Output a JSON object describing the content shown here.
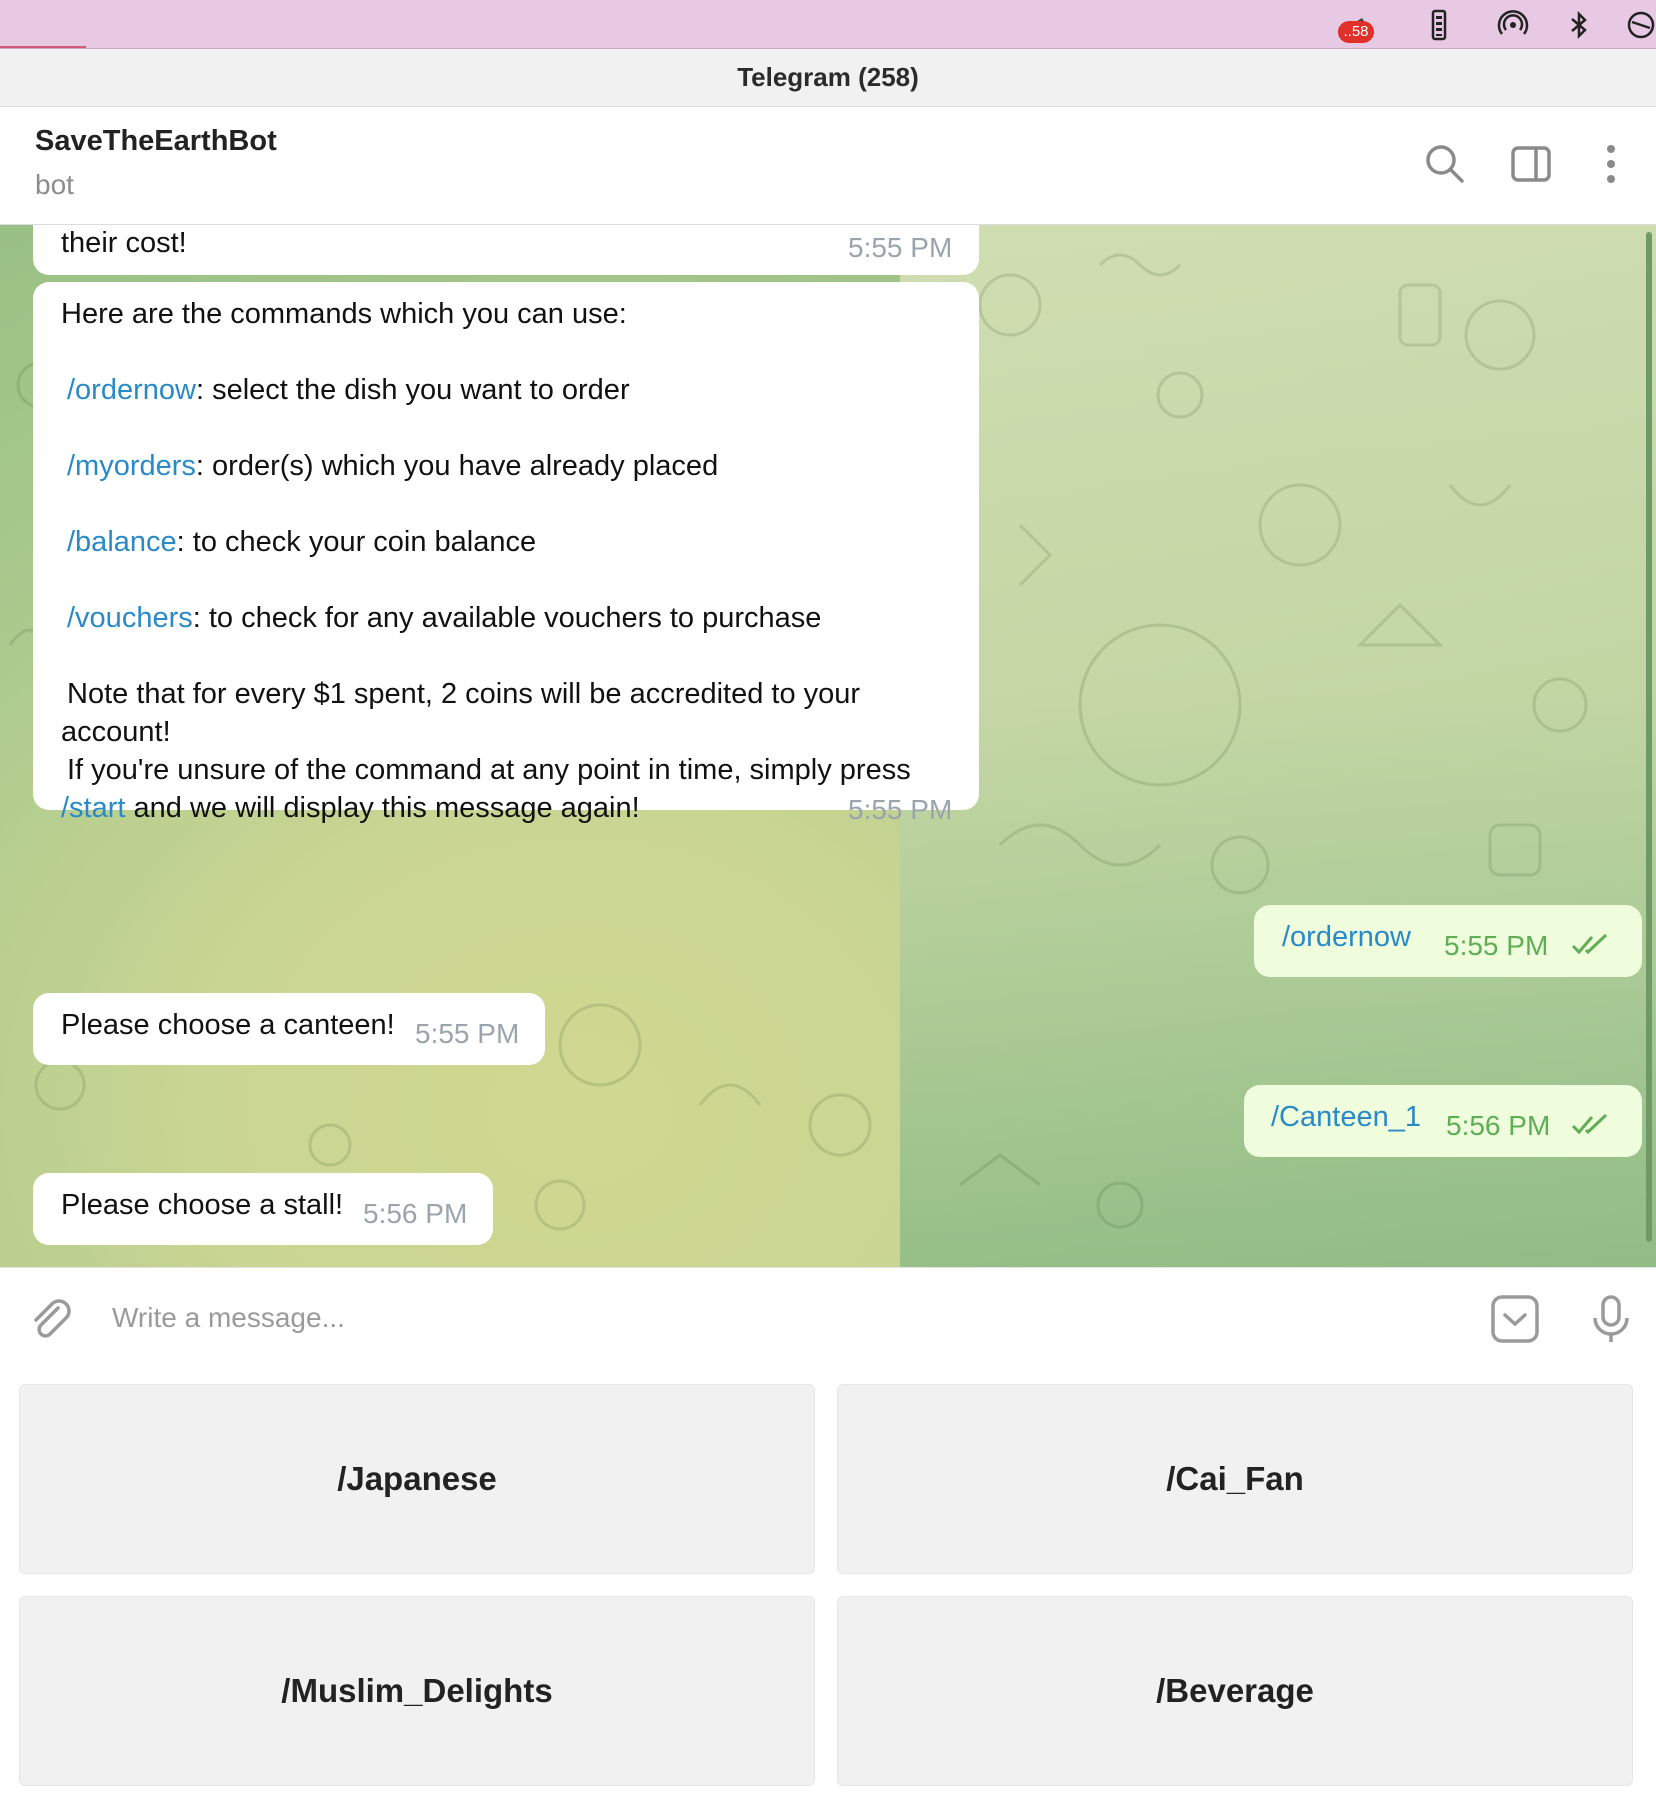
{
  "menubar": {
    "badge": "..58",
    "icons": [
      "app-icon",
      "battery-icon",
      "airdrop-icon",
      "bluetooth-icon",
      "control-center-icon"
    ]
  },
  "window": {
    "title": "Telegram (258)"
  },
  "header": {
    "name": "SaveTheEarthBot",
    "subtitle": "bot"
  },
  "messages": {
    "m1": {
      "text": "their cost!",
      "time": "5:55 PM"
    },
    "m2": {
      "intro": "Here are the commands which you can use:",
      "l1_cmd": "/ordernow",
      "l1_text": ": select the dish you want to order",
      "l2_cmd": "/myorders",
      "l2_text": ":  order(s) which you have already placed",
      "l3_cmd": "/balance",
      "l3_text": ": to check your coin balance",
      "l4_cmd": "/vouchers",
      "l4_text": ": to check for any available vouchers to purchase",
      "note1": "Note that for every $1 spent, 2 coins will be accredited to your",
      "note2": "account!",
      "unsure1": "If you're unsure of the command at any point in time, simply press",
      "start_cmd": "/start",
      "unsure2": " and we will display this message again!",
      "time": "5:55 PM"
    },
    "m3": {
      "text": "/ordernow",
      "time": "5:55 PM"
    },
    "m4": {
      "text": "Please choose a canteen!",
      "time": "5:55 PM"
    },
    "m5": {
      "text": "/Canteen_1",
      "time": "5:56 PM"
    },
    "m6": {
      "text": "Please choose a stall!",
      "time": "5:56 PM"
    }
  },
  "composer": {
    "placeholder": "Write a message..."
  },
  "keyboard": {
    "b1": "/Japanese",
    "b2": "/Cai_Fan",
    "b3": "/Muslim_Delights",
    "b4": "/Beverage"
  },
  "colors": {
    "link": "#2a8ac8",
    "out_bubble": "#effddd",
    "out_time": "#5fae55"
  }
}
